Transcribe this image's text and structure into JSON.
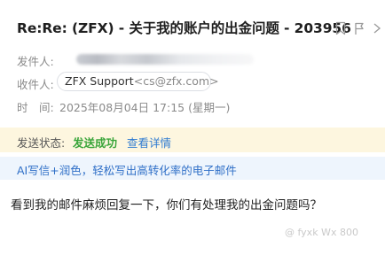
{
  "email": {
    "subject": "Re:Re: (ZFX) - 关于我的账户的出金问题 - 203956",
    "sender_label": "发件人:",
    "recipient_label": "收件人:",
    "recipient_name": "ZFX Support",
    "recipient_email": "<cs@zfx.com>",
    "time_label": "时　间:",
    "time_value": "2025年08月04日 17:15 (星期一)"
  },
  "toolbar": {
    "icons": [
      "bookmark-icon",
      "flag-icon",
      "more-icon"
    ]
  },
  "status": {
    "label": "发送状态:",
    "value": "发送成功",
    "details_link": "查看详情",
    "value_color": "#3aa53a"
  },
  "ai_bar": {
    "text": "AI写信+润色，轻松写出高转化率的电子邮件"
  },
  "body": {
    "text": "看到我的邮件麻烦回复一下，你们有处理我的出金问题吗？"
  },
  "watermark": {
    "text": "@ fyxk  Wx 800"
  },
  "colors": {
    "accent": "#2f7bd1",
    "status_bar_bg": "#fdf6df",
    "ai_bar_bg": "#eef5fd"
  }
}
